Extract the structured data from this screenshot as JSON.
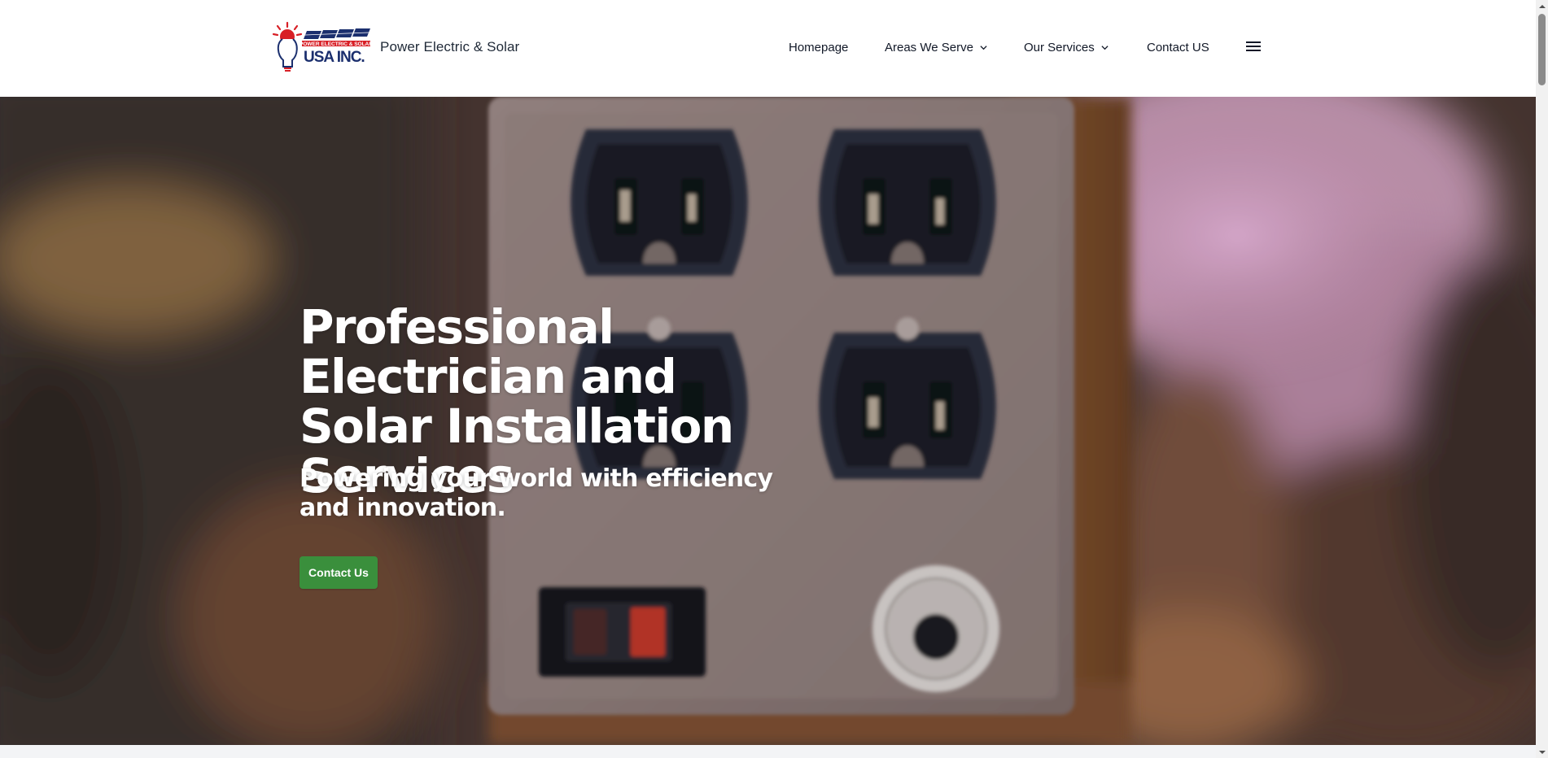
{
  "header": {
    "brand_name": "Power Electric & Solar",
    "logo_icon": "lightbulb-solar-logo",
    "nav": {
      "homepage": "Homepage",
      "areas": "Areas We Serve",
      "services": "Our Services",
      "contact": "Contact US"
    }
  },
  "hero": {
    "title": "Professional Electrician and Solar Installation Services",
    "subtitle": "Powering your world with efficiency and innovation.",
    "cta_label": "Contact Us",
    "background_image": "electrical-outlets-photo"
  },
  "colors": {
    "accent_green": "#3a8f3c",
    "header_bg": "#ffffff",
    "logo_red": "#d81f26",
    "logo_navy": "#1b2f6e"
  }
}
